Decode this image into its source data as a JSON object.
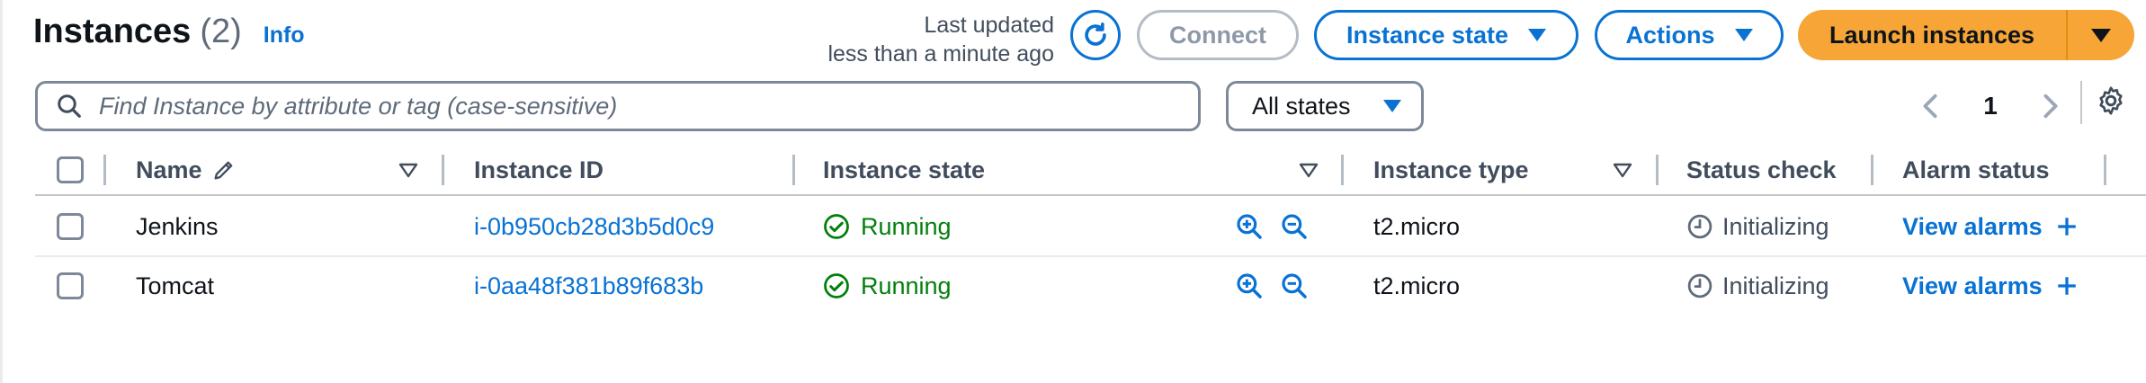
{
  "header": {
    "title": "Instances",
    "count": "(2)",
    "info_link": "Info",
    "last_updated_line1": "Last updated",
    "last_updated_line2": "less than a minute ago",
    "connect_label": "Connect",
    "instance_state_label": "Instance state",
    "actions_label": "Actions",
    "launch_label": "Launch instances"
  },
  "filter": {
    "search_placeholder": "Find Instance by attribute or tag (case-sensitive)",
    "states_label": "All states",
    "page_number": "1"
  },
  "table": {
    "columns": {
      "name": "Name",
      "instance_id": "Instance ID",
      "instance_state": "Instance state",
      "instance_type": "Instance type",
      "status_check": "Status check",
      "alarm_status": "Alarm status"
    },
    "rows": [
      {
        "name": "Jenkins",
        "instance_id": "i-0b950cb28d3b5d0c9",
        "state": "Running",
        "type": "t2.micro",
        "status": "Initializing",
        "alarm": "View alarms"
      },
      {
        "name": "Tomcat",
        "instance_id": "i-0aa48f381b89f683b",
        "state": "Running",
        "type": "t2.micro",
        "status": "Initializing",
        "alarm": "View alarms"
      }
    ]
  },
  "colors": {
    "link": "#0972d3",
    "running": "#037f0c",
    "primary_button": "#f6a536",
    "disabled": "#8d99a8"
  }
}
